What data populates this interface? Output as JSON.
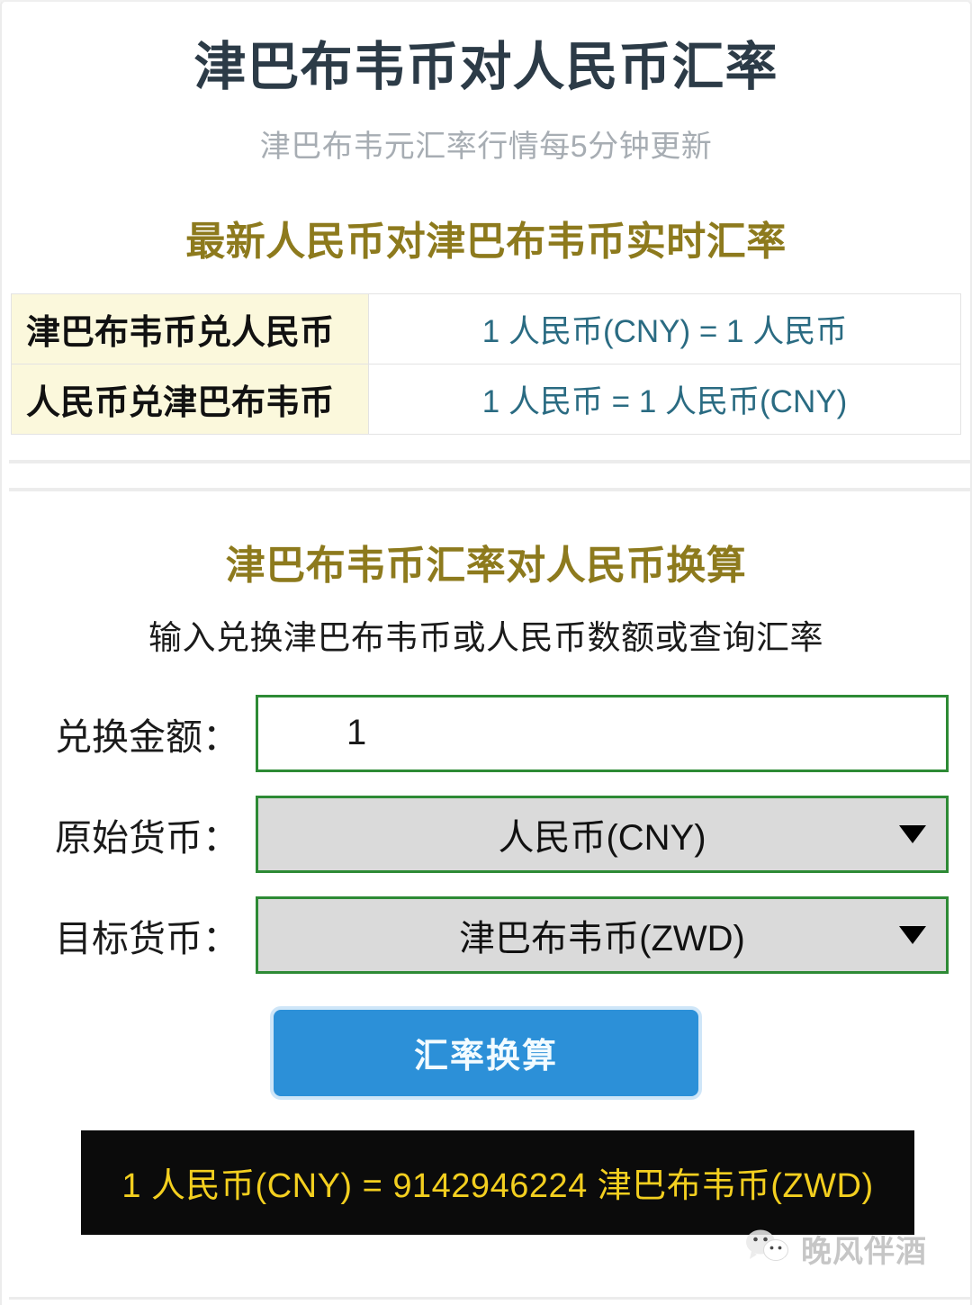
{
  "header": {
    "title": "津巴布韦币对人民币汇率",
    "subtitle": "津巴布韦元汇率行情每5分钟更新"
  },
  "rate_section": {
    "heading": "最新人民币对津巴布韦币实时汇率",
    "rows": [
      {
        "label": "津巴布韦币兑人民币",
        "value": "1 人民币(CNY) = 1 人民币"
      },
      {
        "label": "人民币兑津巴布韦币",
        "value": "1 人民币 = 1 人民币(CNY)"
      }
    ]
  },
  "converter": {
    "heading": "津巴布韦币汇率对人民币换算",
    "subheading": "输入兑换津巴布韦币或人民币数额或查询汇率",
    "amount": {
      "label": "兑换金额：",
      "value": "1",
      "placeholder": "1"
    },
    "from_currency": {
      "label": "原始货币：",
      "selected": "人民币(CNY)",
      "caret_icon": "chevron-down-icon"
    },
    "to_currency": {
      "label": "目标货币：",
      "selected": "津巴布韦币(ZWD)",
      "caret_icon": "chevron-down-icon"
    },
    "submit_label": "汇率换算"
  },
  "result": {
    "text": "1 人民币(CNY) = 9142946224 津巴布韦币(ZWD)"
  },
  "watermark": {
    "icon": "wechat-icon",
    "text": "晚风伴酒"
  },
  "colors": {
    "title": "#2c3b47",
    "subtitle": "#a7adb3",
    "heading_gold": "#8d7a1d",
    "rate_value_teal": "#2a6b82",
    "rate_label_bg": "#fbf8dc",
    "field_border_green": "#2d8a35",
    "select_bg": "#dadada",
    "button_blue": "#2c90d8",
    "button_ring": "#cfe6f8",
    "result_bg": "#0b0b0b",
    "result_text": "#f3cf1f"
  }
}
